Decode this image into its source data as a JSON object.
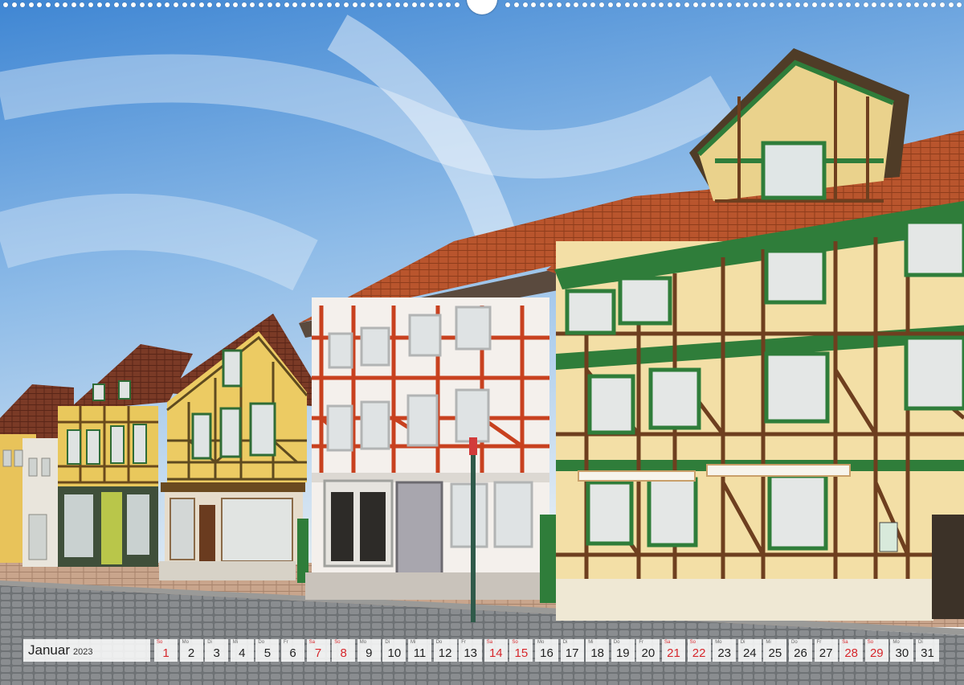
{
  "calendar": {
    "month": "Januar",
    "year": "2023",
    "days": [
      {
        "dow": "So",
        "num": "1",
        "holiday": true
      },
      {
        "dow": "Mo",
        "num": "2",
        "holiday": false
      },
      {
        "dow": "Di",
        "num": "3",
        "holiday": false
      },
      {
        "dow": "Mi",
        "num": "4",
        "holiday": false
      },
      {
        "dow": "Do",
        "num": "5",
        "holiday": false
      },
      {
        "dow": "Fr",
        "num": "6",
        "holiday": false
      },
      {
        "dow": "Sa",
        "num": "7",
        "holiday": true
      },
      {
        "dow": "So",
        "num": "8",
        "holiday": true
      },
      {
        "dow": "Mo",
        "num": "9",
        "holiday": false
      },
      {
        "dow": "Di",
        "num": "10",
        "holiday": false
      },
      {
        "dow": "Mi",
        "num": "11",
        "holiday": false
      },
      {
        "dow": "Do",
        "num": "12",
        "holiday": false
      },
      {
        "dow": "Fr",
        "num": "13",
        "holiday": false
      },
      {
        "dow": "Sa",
        "num": "14",
        "holiday": true
      },
      {
        "dow": "So",
        "num": "15",
        "holiday": true
      },
      {
        "dow": "Mo",
        "num": "16",
        "holiday": false
      },
      {
        "dow": "Di",
        "num": "17",
        "holiday": false
      },
      {
        "dow": "Mi",
        "num": "18",
        "holiday": false
      },
      {
        "dow": "Do",
        "num": "19",
        "holiday": false
      },
      {
        "dow": "Fr",
        "num": "20",
        "holiday": false
      },
      {
        "dow": "Sa",
        "num": "21",
        "holiday": true
      },
      {
        "dow": "So",
        "num": "22",
        "holiday": true
      },
      {
        "dow": "Mo",
        "num": "23",
        "holiday": false
      },
      {
        "dow": "Di",
        "num": "24",
        "holiday": false
      },
      {
        "dow": "Mi",
        "num": "25",
        "holiday": false
      },
      {
        "dow": "Do",
        "num": "26",
        "holiday": false
      },
      {
        "dow": "Fr",
        "num": "27",
        "holiday": false
      },
      {
        "dow": "Sa",
        "num": "28",
        "holiday": true
      },
      {
        "dow": "So",
        "num": "29",
        "holiday": true
      },
      {
        "dow": "Mo",
        "num": "30",
        "holiday": false
      },
      {
        "dow": "Di",
        "num": "31",
        "holiday": false
      }
    ]
  },
  "colors": {
    "holiday": "#d6262b",
    "sky_top": "#4f8fd6",
    "roof": "#b8522a",
    "timber_brown": "#6e3f1f",
    "timber_red": "#c8411f",
    "window_green": "#2f7d3a",
    "wall_cream": "#f3dfa6",
    "cobblestone": "#6b6f73"
  },
  "photo": {
    "subject": "half-timbered-houses-street"
  }
}
